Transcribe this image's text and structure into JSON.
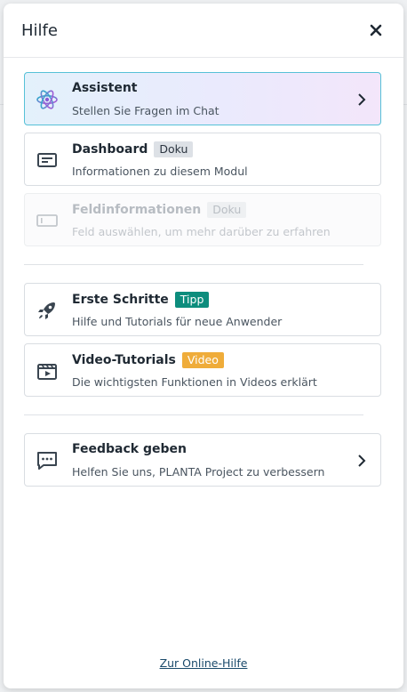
{
  "header": {
    "title": "Hilfe"
  },
  "items": [
    {
      "title": "Assistent",
      "subtitle": "Stellen Sie Fragen im Chat"
    },
    {
      "title": "Dashboard",
      "badge": "Doku",
      "subtitle": "Informationen zu diesem Modul"
    },
    {
      "title": "Feldinformationen",
      "badge": "Doku",
      "subtitle": "Feld auswählen, um mehr darüber zu erfahren"
    },
    {
      "title": "Erste Schritte",
      "badge": "Tipp",
      "subtitle": "Hilfe und Tutorials für neue Anwender"
    },
    {
      "title": "Video-Tutorials",
      "badge": "Video",
      "subtitle": "Die wichtigsten Funktionen in Videos erklärt"
    },
    {
      "title": "Feedback geben",
      "subtitle": "Helfen Sie uns, PLANTA Project zu verbessern"
    }
  ],
  "footer": {
    "link_label": "Zur Online-Hilfe"
  },
  "colors": {
    "teal_badge": "#0d8d7d",
    "orange_badge": "#efac3a",
    "assistant_border": "#56c1d7"
  }
}
